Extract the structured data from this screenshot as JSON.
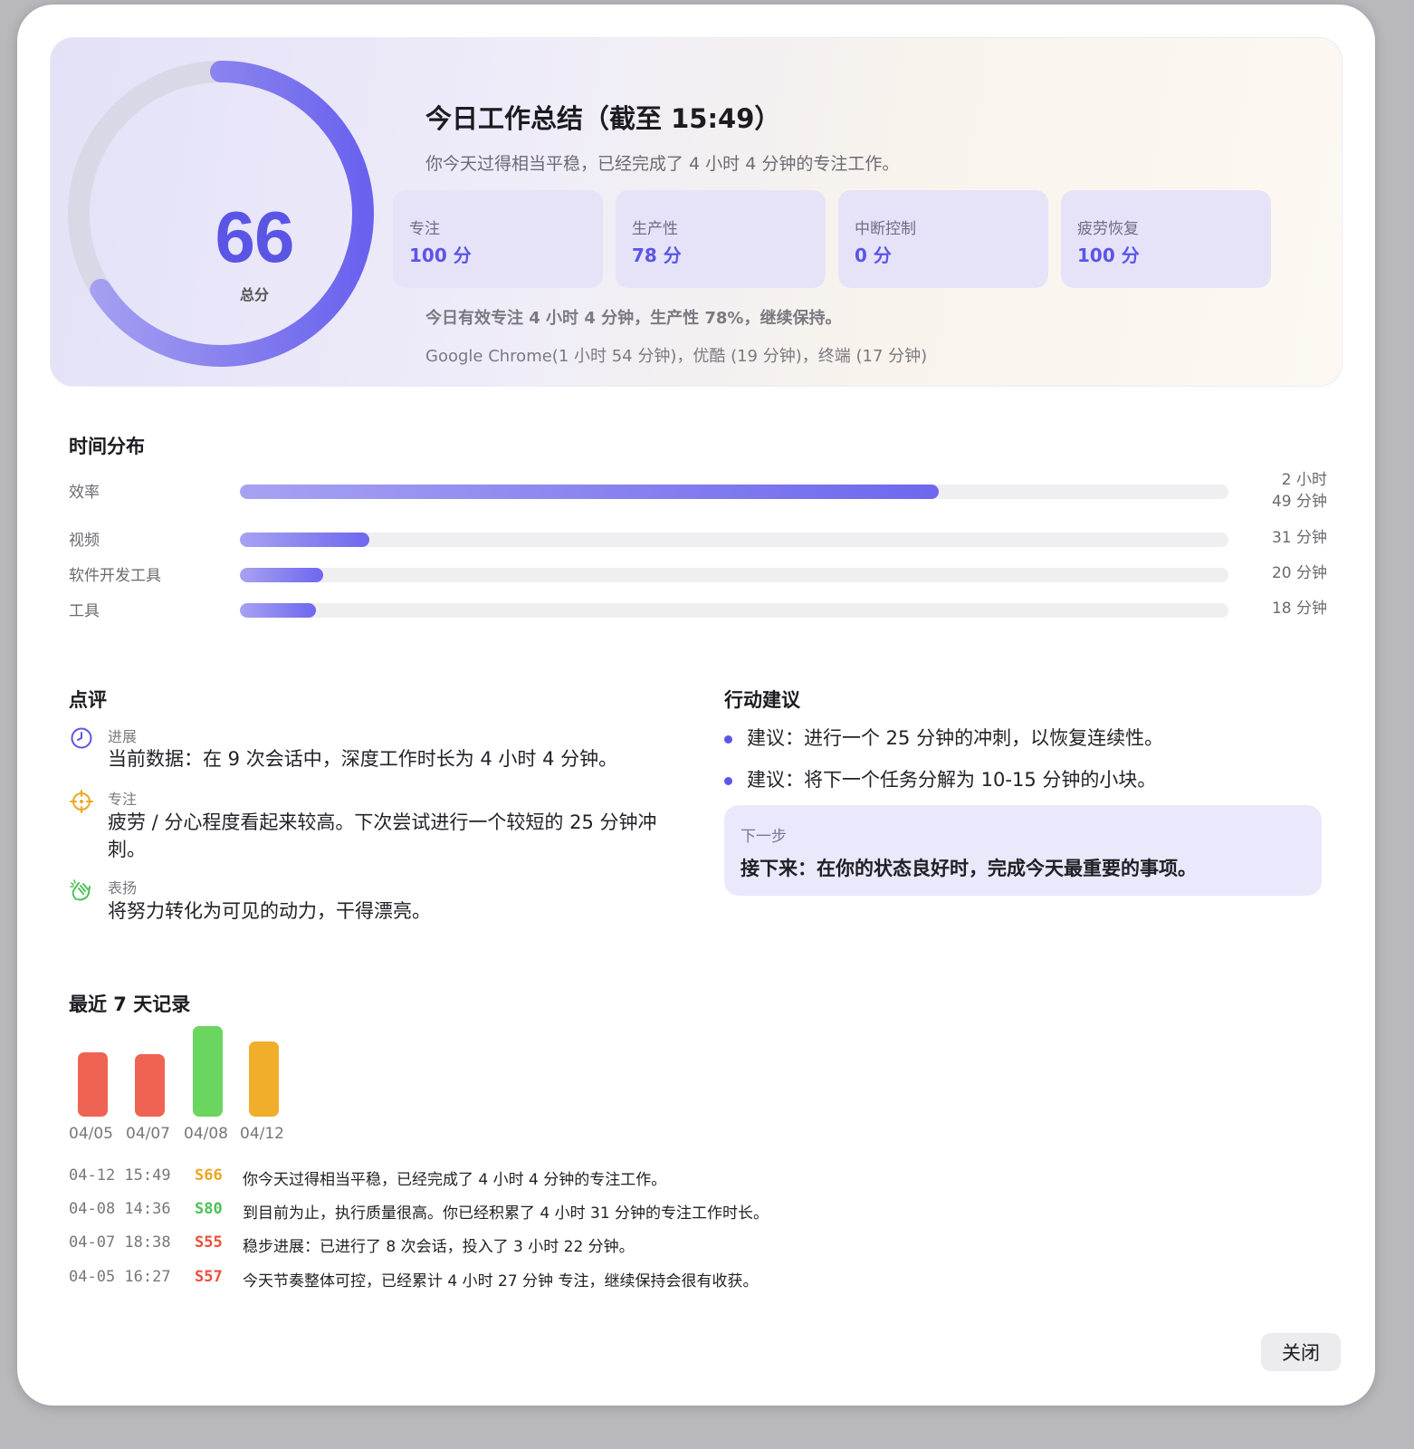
{
  "summary": {
    "score": "66",
    "score_label": "总分",
    "score_fraction": 0.66,
    "title": "今日工作总结（截至 15:49）",
    "subtitle": "你今天过得相当平稳，已经完成了 4 小时 4 分钟的专注工作。",
    "metrics": [
      {
        "label": "专注",
        "value": "100 分"
      },
      {
        "label": "生产性",
        "value": "78 分"
      },
      {
        "label": "中断控制",
        "value": "0 分"
      },
      {
        "label": "疲劳恢复",
        "value": "100 分"
      }
    ],
    "line1": "今日有效专注 4 小时 4 分钟，生产性 78%，继续保持。",
    "line2": "Google Chrome(1 小时 54 分钟)，优酷 (19 分钟)，终端 (17 分钟)"
  },
  "distribution": {
    "title": "时间分布",
    "rows": [
      {
        "label": "效率",
        "time": "2 小时\n49 分钟",
        "fraction": 0.707
      },
      {
        "label": "视频",
        "time": "31 分钟",
        "fraction": 0.131
      },
      {
        "label": "软件开发工具",
        "time": "20 分钟",
        "fraction": 0.084
      },
      {
        "label": "工具",
        "time": "18 分钟",
        "fraction": 0.077
      }
    ]
  },
  "review": {
    "title": "点评",
    "items": [
      {
        "icon": "clock-icon",
        "category": "进展",
        "text": "当前数据：在 9 次会话中，深度工作时长为 4 小时 4 分钟。"
      },
      {
        "icon": "target-icon",
        "category": "专注",
        "text": "疲劳 / 分心程度看起来较高。下次尝试进行一个较短的 25 分钟冲刺。"
      },
      {
        "icon": "clapping-hands-icon",
        "category": "表扬",
        "text": "将努力转化为可见的动力，干得漂亮。"
      }
    ]
  },
  "suggestions": {
    "title": "行动建议",
    "items": [
      "建议：进行一个 25 分钟的冲刺，以恢复连续性。",
      "建议：将下一个任务分解为 10-15 分钟的小块。"
    ],
    "next_label": "下一步",
    "next_text": "接下来：在你的状态良好时，完成今天最重要的事项。"
  },
  "history": {
    "title": "最近 7 天记录",
    "chart": [
      {
        "date": "04/05",
        "score": 57,
        "color": "#ef6354"
      },
      {
        "date": "04/07",
        "score": 55,
        "color": "#ef6354"
      },
      {
        "date": "04/08",
        "score": 80,
        "color": "#6ad65f"
      },
      {
        "date": "04/12",
        "score": 66,
        "color": "#f0ae2b"
      }
    ],
    "records": [
      {
        "time": "04-12 15:49",
        "score": "S66",
        "color": "#e9a623",
        "text": "你今天过得相当平稳，已经完成了 4 小时 4 分钟的专注工作。"
      },
      {
        "time": "04-08 14:36",
        "score": "S80",
        "color": "#4cc15a",
        "text": "到目前为止，执行质量很高。你已经积累了 4 小时 31 分钟的专注工作时长。"
      },
      {
        "time": "04-07 18:38",
        "score": "S55",
        "color": "#ea4f3c",
        "text": "稳步进展：已进行了 8 次会话，投入了 3 小时 22 分钟。"
      },
      {
        "time": "04-05 16:27",
        "score": "S57",
        "color": "#ea4f3c",
        "text": "今天节奏整体可控，已经累计 4 小时 27 分钟 专注，继续保持会很有收获。"
      }
    ]
  },
  "close_label": "关闭",
  "colors": {
    "accent": "#5b55e6"
  }
}
